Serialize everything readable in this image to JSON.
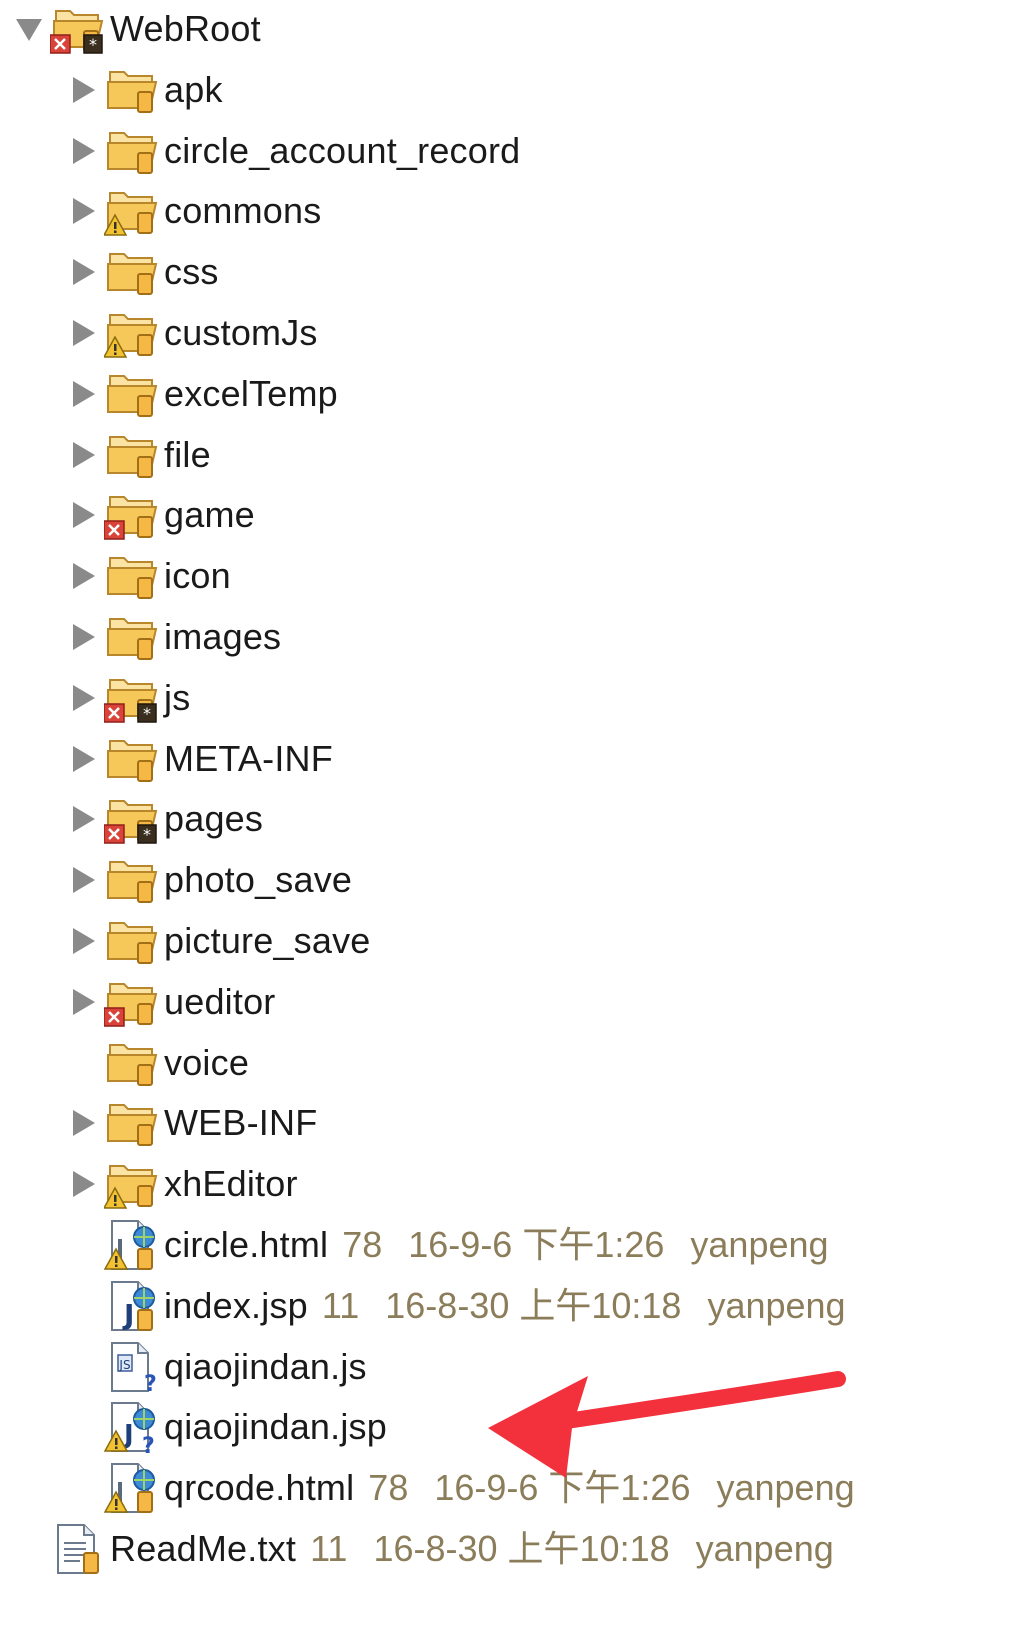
{
  "tree": {
    "root": {
      "label": "WebRoot",
      "expanded": true,
      "icon": "project-folder-error-icon"
    },
    "folders": [
      {
        "label": "apk",
        "icon": "folder-icon"
      },
      {
        "label": "circle_account_record",
        "icon": "folder-icon"
      },
      {
        "label": "commons",
        "icon": "folder-warning-icon"
      },
      {
        "label": "css",
        "icon": "folder-icon"
      },
      {
        "label": "customJs",
        "icon": "folder-warning-icon"
      },
      {
        "label": "excelTemp",
        "icon": "folder-icon"
      },
      {
        "label": "file",
        "icon": "folder-icon"
      },
      {
        "label": "game",
        "icon": "folder-error-icon"
      },
      {
        "label": "icon",
        "icon": "folder-icon"
      },
      {
        "label": "images",
        "icon": "folder-icon"
      },
      {
        "label": "js",
        "icon": "folder-error-modified-icon"
      },
      {
        "label": "META-INF",
        "icon": "folder-icon"
      },
      {
        "label": "pages",
        "icon": "folder-error-modified-icon"
      },
      {
        "label": "photo_save",
        "icon": "folder-icon"
      },
      {
        "label": "picture_save",
        "icon": "folder-icon"
      },
      {
        "label": "ueditor",
        "icon": "folder-error-icon"
      },
      {
        "label": "voice",
        "icon": "folder-icon",
        "no_twisty": true
      },
      {
        "label": "WEB-INF",
        "icon": "folder-icon"
      },
      {
        "label": "xhEditor",
        "icon": "folder-warning-icon"
      }
    ],
    "files": [
      {
        "label": "circle.html",
        "revision": "78",
        "date": "16-9-6 下午1:26",
        "author": "yanpeng",
        "icon": "html-file-warning-icon"
      },
      {
        "label": "index.jsp",
        "revision": "11",
        "date": "16-8-30 上午10:18",
        "author": "yanpeng",
        "icon": "jsp-file-icon"
      },
      {
        "label": "qiaojindan.js",
        "icon": "js-file-unversioned-icon"
      },
      {
        "label": "qiaojindan.jsp",
        "icon": "jsp-file-warning-unversioned-icon"
      },
      {
        "label": "qrcode.html",
        "revision": "78",
        "date": "16-9-6 下午1:26",
        "author": "yanpeng",
        "icon": "html-file-warning-icon"
      }
    ],
    "root_file": {
      "label": "ReadMe.txt",
      "revision": "11",
      "date": "16-8-30 上午10:18",
      "author": "yanpeng",
      "icon": "text-file-icon"
    }
  },
  "colors": {
    "folder_fill": "#f6c85a",
    "folder_stroke": "#b8862b",
    "error_red": "#d9433a",
    "warning_yellow": "#f2c230",
    "meta_text": "#8b7d5a",
    "annotation_arrow": "#f2313d"
  }
}
